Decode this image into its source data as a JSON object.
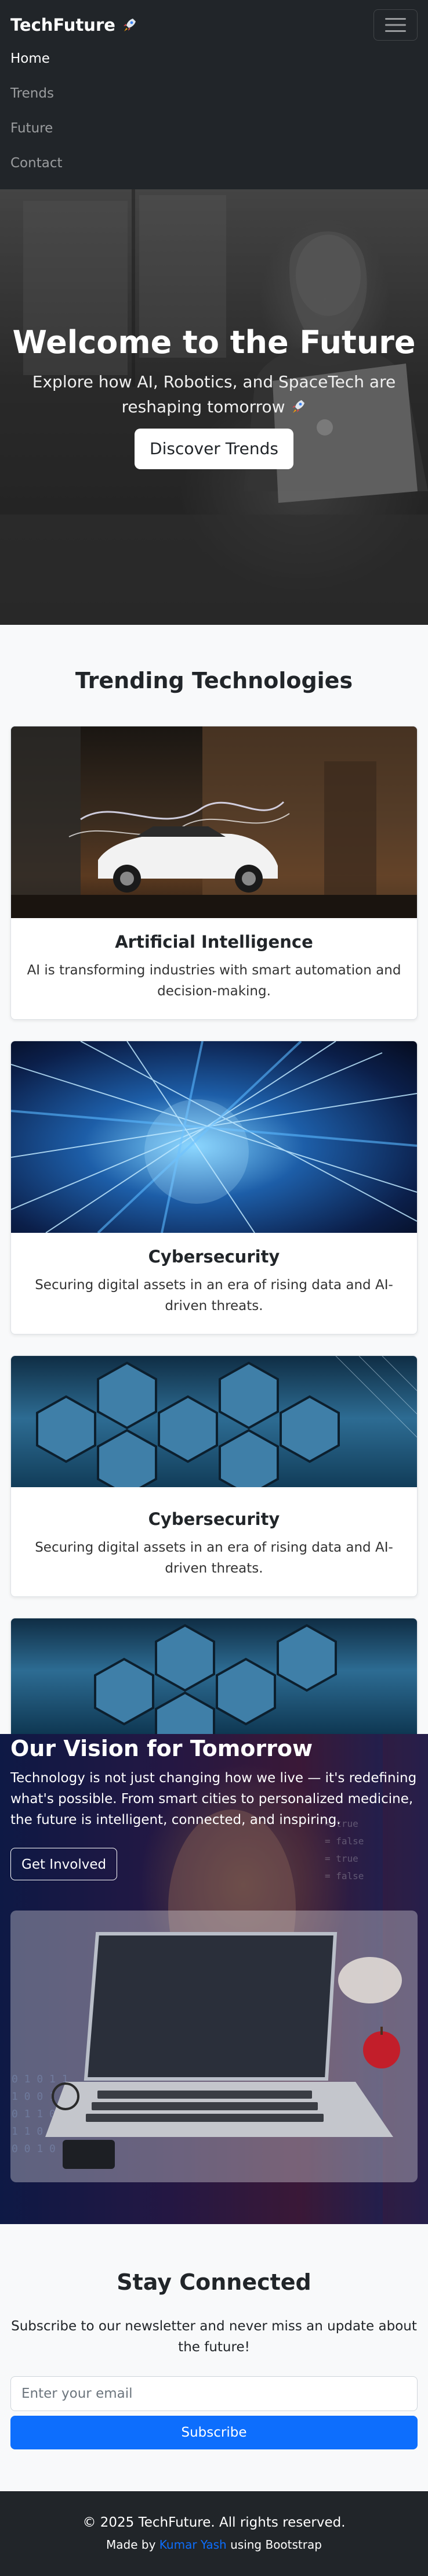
{
  "navbar": {
    "brand": "TechFuture",
    "brand_icon": "rocket-icon",
    "menu_icon": "hamburger-icon",
    "links": [
      "Home",
      "Trends",
      "Future",
      "Contact"
    ],
    "active_link": "Home"
  },
  "hero": {
    "title": "Welcome to the Future",
    "subtitle": "Explore how AI, Robotics, and SpaceTech are reshaping tomorrow",
    "subtitle_icon": "rocket-icon",
    "button": "Discover Trends"
  },
  "trending": {
    "title": "Trending Technologies",
    "cards": [
      {
        "title": "Artificial Intelligence",
        "text": "AI is transforming industries with smart automation and decision-making."
      },
      {
        "title": "Cybersecurity",
        "text": "Securing digital assets in an era of rising data and AI-driven threats."
      },
      {
        "title": "Cybersecurity",
        "text": "Securing digital assets in an era of rising data and AI-driven threats."
      }
    ]
  },
  "vision": {
    "title": "Our Vision for Tomorrow",
    "text": "Technology is not just changing how we live — it's redefining what's possible. From smart cities to personalized medicine, the future is intelligent, connected, and inspiring.",
    "button": "Get Involved"
  },
  "newsletter": {
    "title": "Stay Connected",
    "text": "Subscribe to our newsletter and never miss an update about the future!",
    "placeholder": "Enter your email",
    "button": "Subscribe"
  },
  "footer": {
    "copyright": "© 2025 TechFuture. All rights reserved.",
    "made_by_prefix": "Made by ",
    "author": "Kumar Yash",
    "made_by_suffix": " using Bootstrap"
  },
  "colors": {
    "navbar_bg": "#212529",
    "primary": "#0d6efd",
    "page_bg": "#f8f9fa"
  }
}
